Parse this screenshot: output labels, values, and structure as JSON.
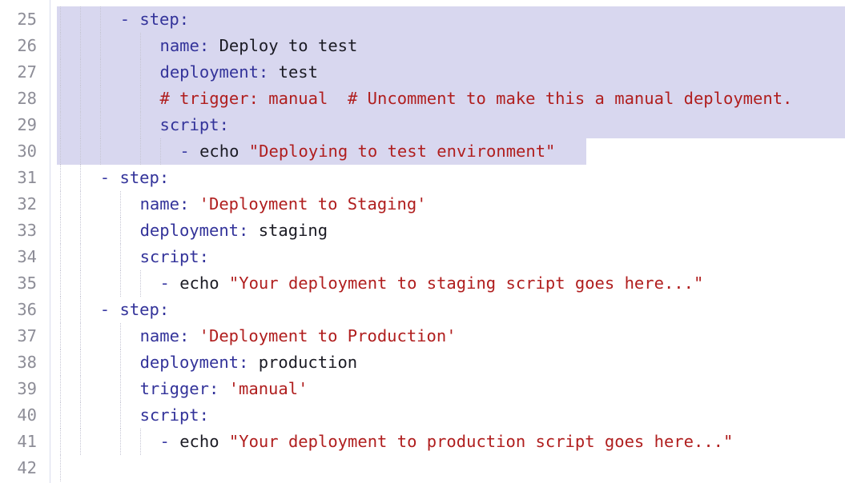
{
  "editor": {
    "lines": [
      {
        "num": "25",
        "tokens": [
          {
            "t": "- ",
            "c": "dash"
          },
          {
            "t": "step",
            "c": "key"
          },
          {
            "t": ":",
            "c": "key"
          }
        ]
      },
      {
        "num": "26",
        "tokens": [
          {
            "t": "name",
            "c": "key"
          },
          {
            "t": ": ",
            "c": "key"
          },
          {
            "t": "Deploy to test",
            "c": "plain"
          }
        ]
      },
      {
        "num": "27",
        "tokens": [
          {
            "t": "deployment",
            "c": "key"
          },
          {
            "t": ": ",
            "c": "key"
          },
          {
            "t": "test",
            "c": "plain"
          }
        ]
      },
      {
        "num": "28",
        "tokens": [
          {
            "t": "# trigger: manual  # Uncomment to make this a manual deployment.",
            "c": "comment"
          }
        ]
      },
      {
        "num": "29",
        "tokens": [
          {
            "t": "script",
            "c": "key"
          },
          {
            "t": ":",
            "c": "key"
          }
        ]
      },
      {
        "num": "30",
        "tokens": [
          {
            "t": "- ",
            "c": "dash"
          },
          {
            "t": "echo ",
            "c": "plain"
          },
          {
            "t": "\"Deploying to test environment\"",
            "c": "str"
          }
        ]
      },
      {
        "num": "31",
        "tokens": [
          {
            "t": "- ",
            "c": "dash"
          },
          {
            "t": "step",
            "c": "key"
          },
          {
            "t": ":",
            "c": "key"
          }
        ]
      },
      {
        "num": "32",
        "tokens": [
          {
            "t": "name",
            "c": "key"
          },
          {
            "t": ": ",
            "c": "key"
          },
          {
            "t": "'Deployment to Staging'",
            "c": "str"
          }
        ]
      },
      {
        "num": "33",
        "tokens": [
          {
            "t": "deployment",
            "c": "key"
          },
          {
            "t": ": ",
            "c": "key"
          },
          {
            "t": "staging",
            "c": "plain"
          }
        ]
      },
      {
        "num": "34",
        "tokens": [
          {
            "t": "script",
            "c": "key"
          },
          {
            "t": ":",
            "c": "key"
          }
        ]
      },
      {
        "num": "35",
        "tokens": [
          {
            "t": "- ",
            "c": "dash"
          },
          {
            "t": "echo ",
            "c": "plain"
          },
          {
            "t": "\"Your deployment to staging script goes here...\"",
            "c": "str"
          }
        ]
      },
      {
        "num": "36",
        "tokens": [
          {
            "t": "- ",
            "c": "dash"
          },
          {
            "t": "step",
            "c": "key"
          },
          {
            "t": ":",
            "c": "key"
          }
        ]
      },
      {
        "num": "37",
        "tokens": [
          {
            "t": "name",
            "c": "key"
          },
          {
            "t": ": ",
            "c": "key"
          },
          {
            "t": "'Deployment to Production'",
            "c": "str"
          }
        ]
      },
      {
        "num": "38",
        "tokens": [
          {
            "t": "deployment",
            "c": "key"
          },
          {
            "t": ": ",
            "c": "key"
          },
          {
            "t": "production",
            "c": "plain"
          }
        ]
      },
      {
        "num": "39",
        "tokens": [
          {
            "t": "trigger",
            "c": "key"
          },
          {
            "t": ": ",
            "c": "key"
          },
          {
            "t": "'manual'",
            "c": "str"
          }
        ]
      },
      {
        "num": "40",
        "tokens": [
          {
            "t": "script",
            "c": "key"
          },
          {
            "t": ":",
            "c": "key"
          }
        ]
      },
      {
        "num": "41",
        "tokens": [
          {
            "t": "- ",
            "c": "dash"
          },
          {
            "t": "echo ",
            "c": "plain"
          },
          {
            "t": "\"Your deployment to production script goes here...\"",
            "c": "str"
          }
        ]
      },
      {
        "num": "42",
        "tokens": []
      }
    ]
  },
  "colors": {
    "selection": "#d8d7ef",
    "key": "#33339a",
    "string": "#b01e1e",
    "line_number": "#8d8d97"
  }
}
